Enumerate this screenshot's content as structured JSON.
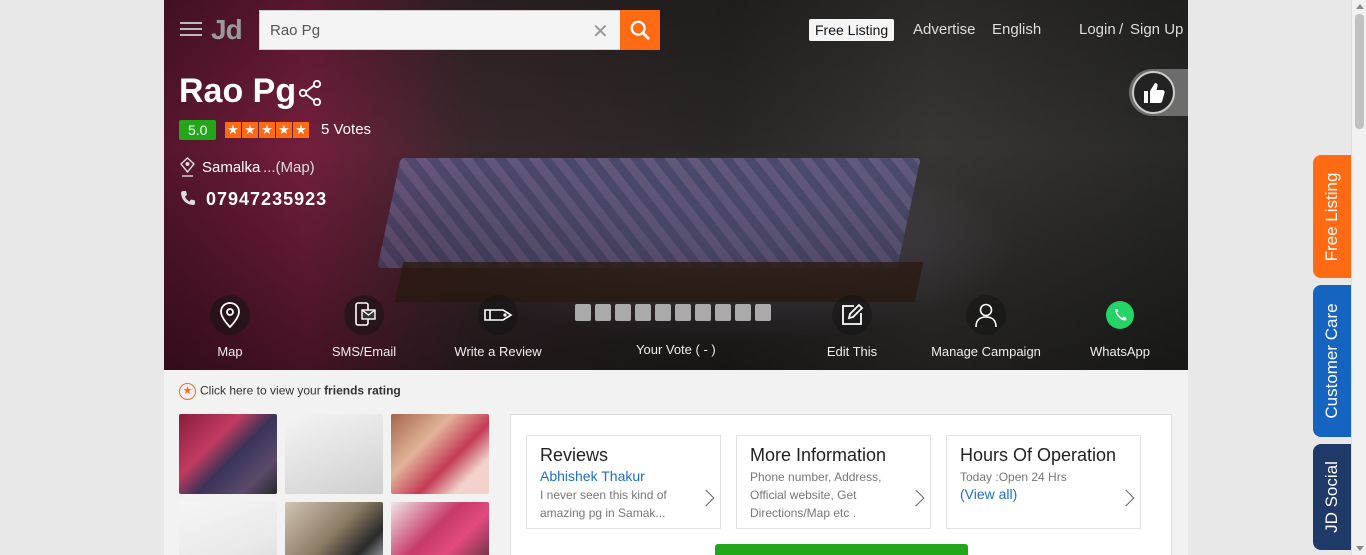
{
  "header": {
    "logo": "Jd",
    "search_value": "Rao Pg",
    "nav": {
      "free_listing": "Free Listing",
      "advertise": "Advertise",
      "language": "English",
      "login": "Login",
      "sep": "/",
      "signup": "Sign Up"
    }
  },
  "business": {
    "name": "Rao Pg",
    "rating": "5.0",
    "stars": [
      "★",
      "★",
      "★",
      "★",
      "★"
    ],
    "votes": "5 Votes",
    "area": "Samalka",
    "map_link": "...(Map)",
    "phone": "07947235923"
  },
  "actions": {
    "map": "Map",
    "sms": "SMS/Email",
    "review": "Write a Review",
    "vote": "Your Vote ( - )",
    "edit": "Edit This",
    "campaign": "Manage Campaign",
    "whatsapp": "WhatsApp"
  },
  "friends": {
    "prefix": "Click here to view your",
    "bold": "friends rating"
  },
  "cards": {
    "reviews": {
      "title": "Reviews",
      "name": "Abhishek Thakur",
      "text": "I never seen this kind of amazing pg in Samak..."
    },
    "info": {
      "title": "More Information",
      "text": "Phone number, Address, Official website, Get Directions/Map etc ."
    },
    "hours": {
      "title": "Hours Of Operation",
      "today": "Today :Open 24 Hrs",
      "view": "(View all)"
    }
  },
  "side_tabs": {
    "free_listing": "Free Listing",
    "customer_care": "Customer Care",
    "jd_social": "JD Social"
  },
  "colors": {
    "accent": "#ff6a13",
    "rating_green": "#23a71a",
    "link_blue": "#1a6fc9",
    "tab_blue": "#1565c0",
    "tab_navy": "#1f3a68"
  }
}
